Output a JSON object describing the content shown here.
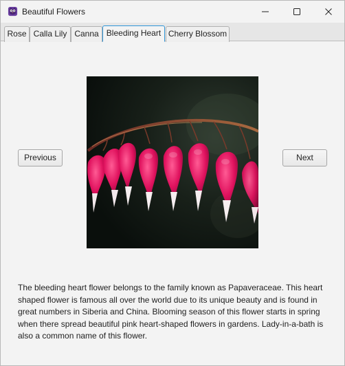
{
  "window": {
    "title": "Beautiful Flowers",
    "icon": "purple-owl-app-icon",
    "controls": [
      "minimize-icon",
      "maximize-icon",
      "close-icon"
    ]
  },
  "tabs": [
    {
      "label": "Rose",
      "active": false
    },
    {
      "label": "Calla Lily",
      "active": false
    },
    {
      "label": "Canna",
      "active": false
    },
    {
      "label": "Bleeding Heart",
      "active": true
    },
    {
      "label": "Cherry Blossom",
      "active": false
    }
  ],
  "nav": {
    "previous_label": "Previous",
    "next_label": "Next"
  },
  "flower": {
    "name": "Bleeding Heart",
    "description": "The bleeding heart flower belongs to the family known as Papaveraceae. This heart shaped flower is famous all over the world due to its unique beauty and is found in great numbers in Siberia and China. Blooming season of this flower starts in spring when there spread beautiful pink heart-shaped flowers in gardens. Lady-in-a-bath is also a common name of this flower."
  },
  "colors": {
    "accent": "#2f95d8",
    "flower_pink": "#e0125e",
    "background": "#f3f3f3"
  }
}
